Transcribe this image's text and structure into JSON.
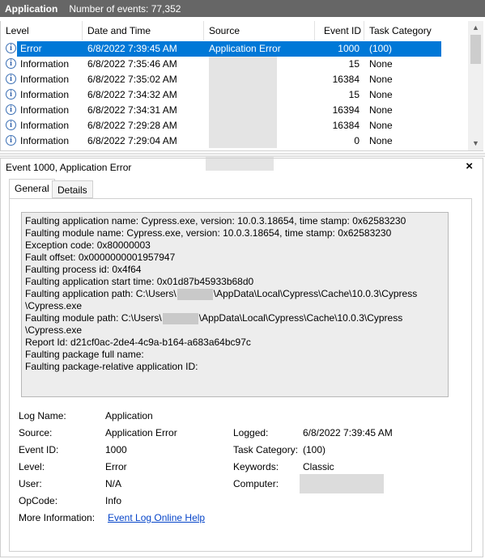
{
  "titlebar": {
    "app": "Application",
    "count": "Number of events: 77,352"
  },
  "grid": {
    "columns": [
      "Level",
      "Date and Time",
      "Source",
      "Event ID",
      "Task Category"
    ],
    "rows": [
      {
        "level": "Error",
        "date": "6/8/2022 7:39:45 AM",
        "source": "Application Error",
        "id": "1000",
        "category": "(100)",
        "selected": true
      },
      {
        "level": "Information",
        "date": "6/8/2022 7:35:46 AM",
        "source": "",
        "id": "15",
        "category": "None"
      },
      {
        "level": "Information",
        "date": "6/8/2022 7:35:02 AM",
        "source": "",
        "id": "16384",
        "category": "None"
      },
      {
        "level": "Information",
        "date": "6/8/2022 7:34:32 AM",
        "source": "",
        "id": "15",
        "category": "None"
      },
      {
        "level": "Information",
        "date": "6/8/2022 7:34:31 AM",
        "source": "",
        "id": "16394",
        "category": "None"
      },
      {
        "level": "Information",
        "date": "6/8/2022 7:29:28 AM",
        "source": "",
        "id": "16384",
        "category": "None"
      },
      {
        "level": "Information",
        "date": "6/8/2022 7:29:04 AM",
        "source": "",
        "id": "0",
        "category": "None"
      }
    ]
  },
  "details": {
    "header": "Event 1000, Application Error",
    "close": "×",
    "tabs": [
      "General",
      "Details"
    ],
    "message": {
      "l1": "Faulting application name: Cypress.exe, version: 10.0.3.18654, time stamp: 0x62583230",
      "l2": "Faulting module name: Cypress.exe, version: 10.0.3.18654, time stamp: 0x62583230",
      "l3": "Exception code: 0x80000003",
      "l4": "Fault offset: 0x0000000001957947",
      "l5": "Faulting process id: 0x4f64",
      "l6": "Faulting application start time: 0x01d87b45933b68d0",
      "l7a": "Faulting application path: C:\\Users\\",
      "l7b": "\\AppData\\Local\\Cypress\\Cache\\10.0.3\\Cypress",
      "l8": "\\Cypress.exe",
      "l9a": "Faulting module path: C:\\Users\\",
      "l9b": "\\AppData\\Local\\Cypress\\Cache\\10.0.3\\Cypress",
      "l10": "\\Cypress.exe",
      "l11": "Report Id: d21cf0ac-2de4-4c9a-b164-a683a64bc97c",
      "l12": "Faulting package full name:",
      "l13": "Faulting package-relative application ID:"
    },
    "fields": {
      "log_name_label": "Log Name:",
      "log_name": "Application",
      "source_label": "Source:",
      "source": "Application Error",
      "event_id_label": "Event ID:",
      "event_id": "1000",
      "level_label": "Level:",
      "level": "Error",
      "user_label": "User:",
      "user": "N/A",
      "opcode_label": "OpCode:",
      "opcode": "Info",
      "more_info_label": "More Information:",
      "more_info_link": "Event Log Online Help",
      "logged_label": "Logged:",
      "logged": "6/8/2022 7:39:45 AM",
      "task_category_label": "Task Category:",
      "task_category": "(100)",
      "keywords_label": "Keywords:",
      "keywords": "Classic",
      "computer_label": "Computer:"
    }
  }
}
